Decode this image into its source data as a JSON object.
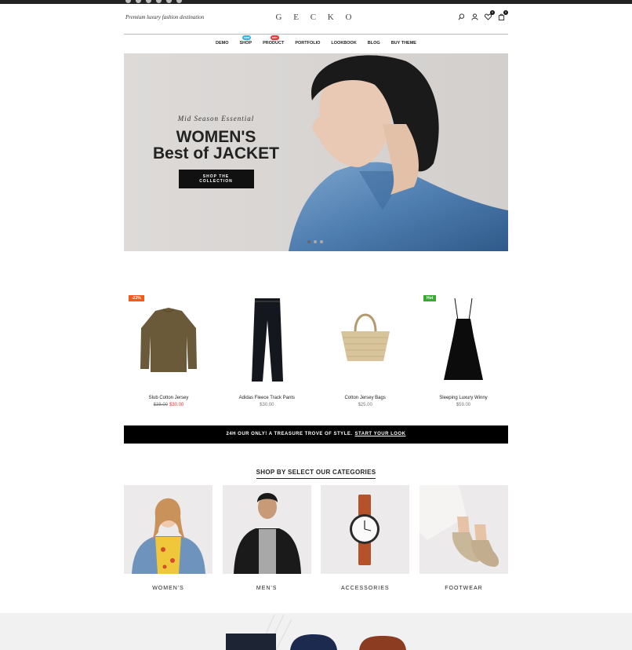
{
  "header": {
    "tagline": "Premium luxury fashion destination",
    "logo": "G E C K O",
    "wishlist_count": "0",
    "cart_count": "0"
  },
  "nav": {
    "items": [
      {
        "label": "DEMO"
      },
      {
        "label": "SHOP",
        "badge": "new",
        "badge_color": "#3bb3e6"
      },
      {
        "label": "PRODUCT",
        "badge": "sale",
        "badge_color": "#e33"
      },
      {
        "label": "PORTFOLIO"
      },
      {
        "label": "LOOKBOOK"
      },
      {
        "label": "BLOG"
      },
      {
        "label": "BUY THEME"
      }
    ]
  },
  "hero": {
    "subtitle": "Mid Season Essential",
    "title_line1": "WOMEN'S",
    "title_line2": "Best of JACKET",
    "button": "SHOP THE COLLECTION"
  },
  "products": [
    {
      "name": "Slub Cotton Jersey",
      "old_price": "$38.00",
      "price": "$30.00",
      "tag": "-23%",
      "tag_color": "#f05a1a"
    },
    {
      "name": "Adidas Fleece Track Pants",
      "price": "$30.00"
    },
    {
      "name": "Cotton Jersey Bags",
      "price": "$25.00"
    },
    {
      "name": "Sleeping Luxury Winny",
      "price": "$59.00",
      "tag": "Hot",
      "tag_color": "#3aa835"
    }
  ],
  "promo": {
    "text": "24H OUR ONLY! A TREASURE TROVE OF STYLE.",
    "link": "START YOUR LOOK"
  },
  "categories": {
    "title": "SHOP BY SELECT OUR CATEGORIES",
    "items": [
      {
        "label": "WOMEN'S"
      },
      {
        "label": "MEN'S"
      },
      {
        "label": "ACCESSORIES"
      },
      {
        "label": "FOOTWEAR"
      }
    ]
  }
}
